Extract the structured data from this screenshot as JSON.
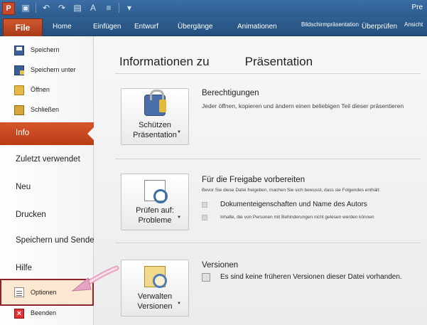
{
  "window": {
    "title": "Pre"
  },
  "quick_access": [
    "save-icon",
    "undo-icon",
    "redo-icon",
    "format-icon",
    "font-icon",
    "list-icon",
    "customize-icon"
  ],
  "ribbon": {
    "file": "File",
    "tabs": [
      "Home",
      "Einfügen",
      "Entwurf",
      "Übergänge",
      "Animationen",
      "Bildschirmpräsentation",
      "Überprüfen",
      "Ansicht"
    ]
  },
  "nav": {
    "commands_top": [
      {
        "label": "Speichern",
        "icon": "save-icon"
      },
      {
        "label": "Speichern unter",
        "icon": "save-as-icon"
      },
      {
        "label": "Öffnen",
        "icon": "open-folder-icon"
      },
      {
        "label": "Schließen",
        "icon": "close-folder-icon"
      }
    ],
    "tabs": [
      "Info",
      "Zuletzt verwendet",
      "Neu",
      "Drucken",
      "Speichern und Senden",
      "Hilfe"
    ],
    "active_tab": "Info",
    "options": "Optionen",
    "exit": "Beenden"
  },
  "main": {
    "title_part1": "Informationen zu",
    "title_part2": "Präsentation",
    "sections": {
      "permissions": {
        "button_line1": "Schützen",
        "button_line2": "Präsentation",
        "title": "Berechtigungen",
        "text": "Jeder öffnen, kopieren und ändern einen beliebigen Teil dieser präsentieren"
      },
      "prepare": {
        "button_line1": "Prüfen auf:",
        "button_line2": "Probleme",
        "title": "Für die Freigabe vorbereiten",
        "text": "Bevor Sie diese Datei freigeben, machen Sie sich bewusst, dass sie Folgendes enthält:",
        "bullet1": "Dokumenteigenschaften und Name des Autors",
        "bullet2": "Inhalte, die von Personen mit Behinderungen nicht gelesen werden können"
      },
      "versions": {
        "button_line1": "Verwalten",
        "button_line2": "Versionen",
        "title": "Versionen",
        "text": "Es sind keine früheren Versionen dieser Datei vorhanden."
      }
    }
  },
  "colors": {
    "accent": "#c9471f",
    "ribbon": "#2a5a8c",
    "highlight_border": "#8c2430",
    "annotation_arrow": "#e8a0c0"
  }
}
